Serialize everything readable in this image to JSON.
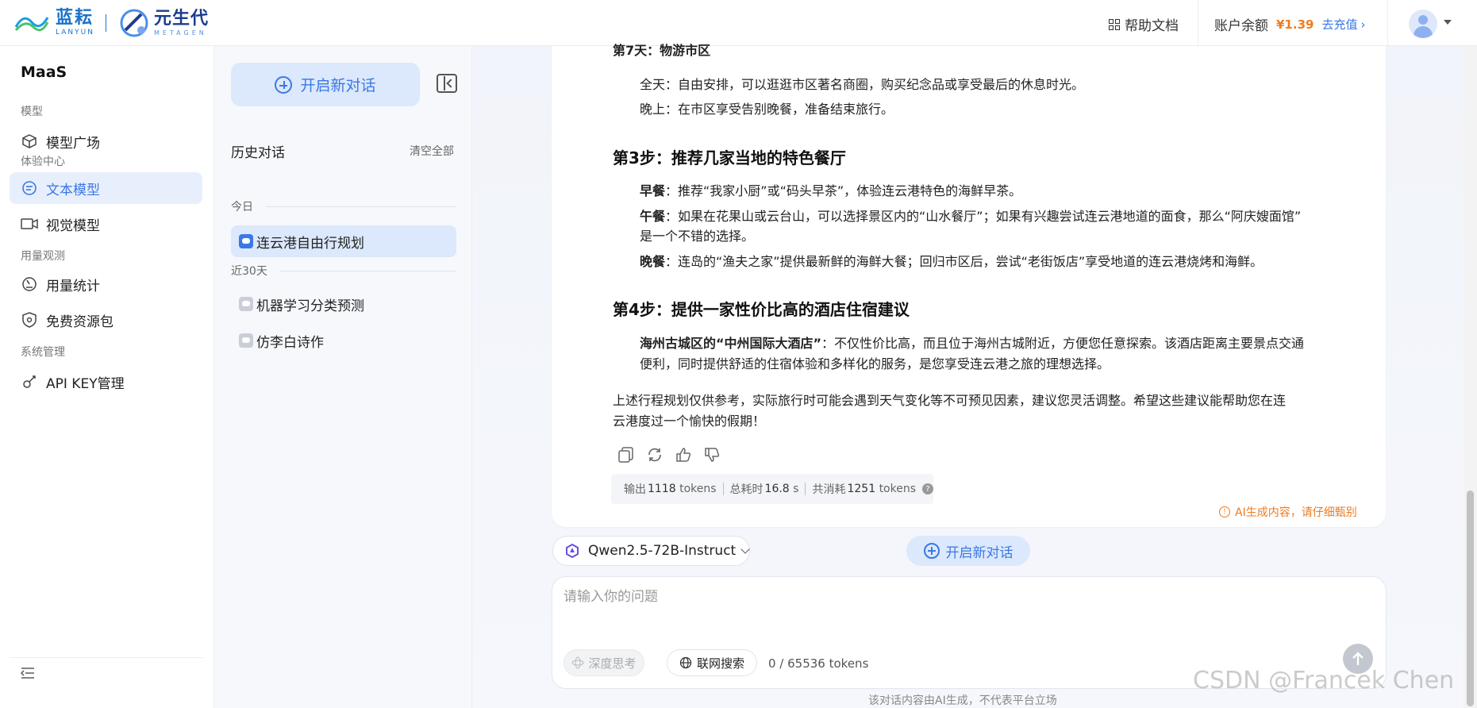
{
  "header": {
    "logo1_cn": "蓝耘",
    "logo1_en": "LANYUN",
    "logo2_cn": "元生代",
    "logo2_en": "METAGEN",
    "help_label": "帮助文档",
    "balance_label": "账户余额",
    "balance_amount": "¥1.39",
    "recharge_label": "去充值",
    "recharge_arrow": "›"
  },
  "nav": {
    "brand": "MaaS",
    "groups": [
      {
        "label": "模型",
        "items": [
          {
            "label": "模型广场",
            "icon": "cube-icon"
          }
        ]
      },
      {
        "label": "体验中心",
        "items": [
          {
            "label": "文本模型",
            "icon": "chat-bubble-icon",
            "active": true
          },
          {
            "label": "视觉模型",
            "icon": "video-camera-icon"
          }
        ]
      },
      {
        "label": "用量观测",
        "items": [
          {
            "label": "用量统计",
            "icon": "gauge-icon"
          },
          {
            "label": "免费资源包",
            "icon": "shield-icon"
          }
        ]
      },
      {
        "label": "系统管理",
        "items": [
          {
            "label": "API KEY管理",
            "icon": "key-icon"
          }
        ]
      }
    ]
  },
  "history": {
    "new_chat_label": "开启新对话",
    "title": "历史对话",
    "clear_label": "清空全部",
    "sections": [
      {
        "label": "今日",
        "items": [
          {
            "label": "连云港自由行规划",
            "active": true
          }
        ]
      },
      {
        "label": "近30天",
        "items": [
          {
            "label": "机器学习分类预测"
          },
          {
            "label": "仿李白诗作"
          }
        ]
      }
    ]
  },
  "message": {
    "day7_heading": "第7天：物游市区",
    "day7_lines": [
      "全天：自由安排，可以逛逛市区著名商圈，购买纪念品或享受最后的休息时光。",
      "晚上：在市区享受告别晚餐，准备结束旅行。"
    ],
    "step3_heading": "第3步：推荐几家当地的特色餐厅",
    "breakfast_label": "早餐",
    "breakfast_text": "：推荐“我家小厨”或“码头早茶”，体验连云港特色的海鲜早茶。",
    "lunch_label": "午餐",
    "lunch_text_1": "：如果在花果山或云台山，可以选择景区内的“山水餐厅”；如果有兴趣尝试连云港地道的面食，那么“阿庆嫂面馆”",
    "lunch_text_2": "是一个不错的选择。",
    "dinner_label": "晚餐",
    "dinner_text": "：连岛的“渔夫之家”提供最新鲜的海鲜大餐；回归市区后，尝试“老街饭店”享受地道的连云港烧烤和海鲜。",
    "step4_heading": "第4步：提供一家性价比高的酒店住宿建议",
    "hotel_label": "海州古城区的“中州国际大酒店”",
    "hotel_text_1": "：不仅性价比高，而且位于海州古城附近，方便您任意探索。该酒店距离主要景点交通",
    "hotel_text_2": "便利，同时提供舒适的住宿体验和多样化的服务，是您享受连云港之旅的理想选择。",
    "closing_1": "上述行程规划仅供参考，实际旅行时可能会遇到天气变化等不可预见因素，建议您灵活调整。希望这些建议能帮助您在连",
    "closing_2": "云港度过一个愉快的假期！"
  },
  "stats": {
    "output_label": "输出",
    "output_value": "1118",
    "output_unit": "tokens",
    "time_label": "总耗时",
    "time_value": "16.8",
    "time_unit": "s",
    "total_label": "共消耗",
    "total_value": "1251",
    "total_unit": "tokens",
    "help_glyph": "?"
  },
  "ai_warning": "AI生成内容，请仔细甄别",
  "composer": {
    "model_name": "Qwen2.5-72B-Instruct",
    "new_chat_label": "开启新对话",
    "placeholder": "请输入你的问题",
    "deep_think_label": "深度思考",
    "web_search_label": "联网搜索",
    "token_count": "0 / 65536 tokens"
  },
  "disclaimer": "该对话内容由AI生成，不代表平台立场",
  "watermark": "CSDN @Francek Chen",
  "colors": {
    "accent": "#3a78e6",
    "warning": "#f07b1d",
    "balance": "#f07b1d"
  }
}
